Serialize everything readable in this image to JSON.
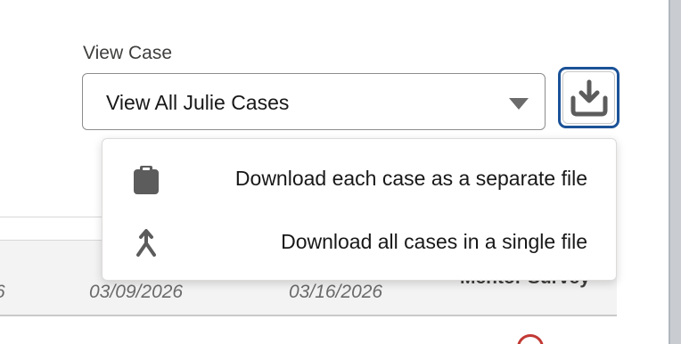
{
  "view_case": {
    "label": "View Case",
    "selected": "View All Julie Cases"
  },
  "toolbar": {
    "download_icon": "download-icon"
  },
  "download_menu": {
    "items": [
      {
        "label": "Download each case as a separate file",
        "icon": "clipboard-icon"
      },
      {
        "label": "Download all cases in a single file",
        "icon": "merge-icon"
      }
    ]
  },
  "table": {
    "dates": [
      "6",
      "03/09/2026",
      "03/16/2026"
    ],
    "column_title": "Mentor Survey"
  },
  "colors": {
    "accent_border": "#1b5297",
    "icon_gray": "#5c5c5c",
    "error_red": "#c23934"
  }
}
